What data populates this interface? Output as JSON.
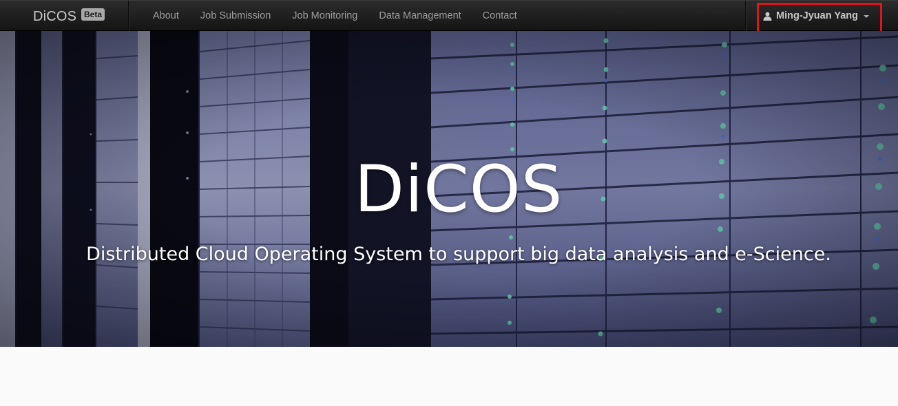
{
  "brand": {
    "name": "DiCOS",
    "badge": "Beta"
  },
  "nav": {
    "links": [
      {
        "label": "About"
      },
      {
        "label": "Job Submission"
      },
      {
        "label": "Job Monitoring"
      },
      {
        "label": "Data Management"
      },
      {
        "label": "Contact"
      }
    ]
  },
  "user": {
    "name": "Ming-Jyuan Yang",
    "icon": "user-icon"
  },
  "hero": {
    "title": "DiCOS",
    "subtitle": "Distributed Cloud Operating System to support big data analysis and e-Science."
  },
  "colors": {
    "navbar": "#1b1b1b",
    "nav_text": "#9d9d9d",
    "highlight": "#e0151b",
    "hero_bg": "#14162b"
  }
}
